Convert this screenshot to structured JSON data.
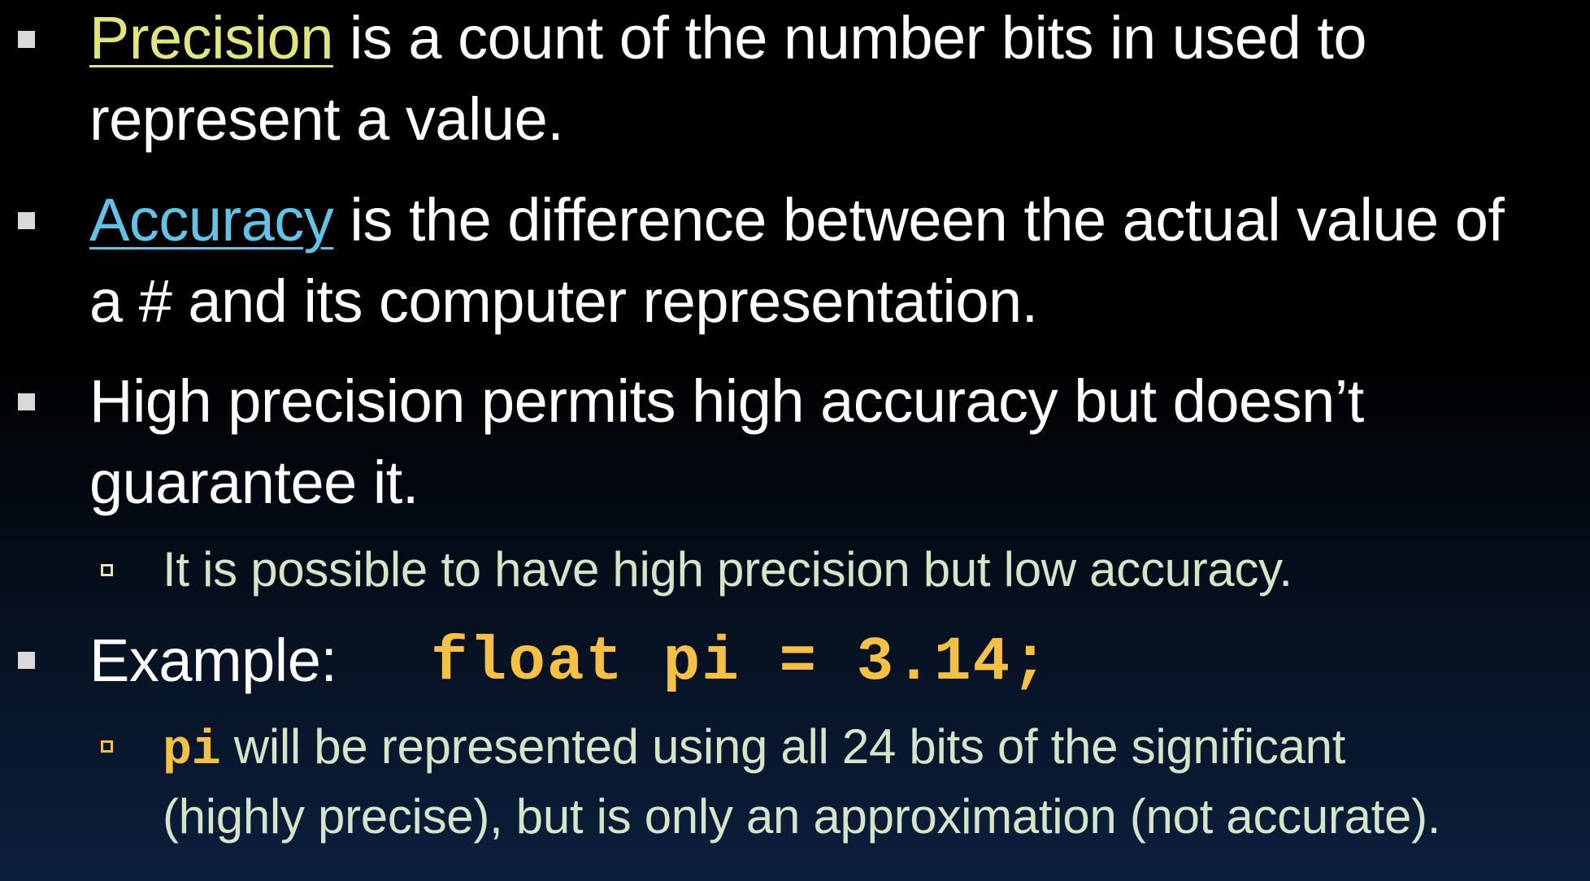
{
  "bullets": [
    {
      "term": "Precision",
      "line1_rest": " is a count of the number bits in used to",
      "line2": "represent a value."
    },
    {
      "term": "Accuracy",
      "line1_rest": " is the difference between the actual value of",
      "line2": "a # and its computer representation."
    },
    {
      "line1": "High precision permits high accuracy but doesn’t",
      "line2": "guarantee it.",
      "sub": "It is possible to have high precision but low accuracy."
    },
    {
      "label": "Example:",
      "code": "float pi = 3.14;",
      "sub_code": "pi",
      "sub_line1_rest": " will be represented using all 24 bits of the significant",
      "sub_line2": "(highly precise), but is only an approximation (not accurate)."
    }
  ],
  "colors": {
    "precision_term": "#e0e67a",
    "accuracy_term": "#5ec4e8",
    "code": "#f6c142",
    "sub_text": "#d6e4c8",
    "bullet_marker": "#d9d9d9"
  }
}
